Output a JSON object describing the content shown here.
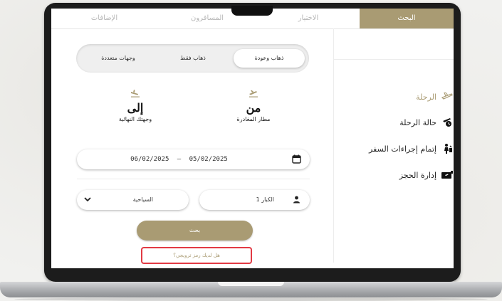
{
  "tabs": [
    {
      "label": "البحث",
      "active": true
    },
    {
      "label": "الاختيار",
      "active": false
    },
    {
      "label": "المسافرون",
      "active": false
    },
    {
      "label": "الإضافات",
      "active": false
    }
  ],
  "sidebar": {
    "items": [
      {
        "label": "الرحلة",
        "icon": "plane-icon"
      },
      {
        "label": "حالة الرحلة",
        "icon": "plane-status-icon"
      },
      {
        "label": "إتمام إجراءات السفر",
        "icon": "traveler-checkin-icon"
      },
      {
        "label": "إدارة الحجز",
        "icon": "ticket-icon"
      }
    ]
  },
  "trip_type": {
    "options": [
      "ذهاب وعودة",
      "ذهاب فقط",
      "وجهات متعددة"
    ],
    "selected": "ذهاب وعودة"
  },
  "origin": {
    "title": "من",
    "subtitle": "مطار المغادرة",
    "icon": "takeoff-icon"
  },
  "destination": {
    "title": "إلى",
    "subtitle": "وجهتك النهائية",
    "icon": "landing-icon"
  },
  "dates": {
    "depart": "05/02/2025",
    "separator": "–",
    "return": "06/02/2025",
    "icon": "calendar-icon"
  },
  "passengers": {
    "label": "1 الكبار",
    "icon": "person-icon"
  },
  "cabin": {
    "label": "السياحية",
    "icon": "chevron-down-icon"
  },
  "search_button": "بحث",
  "promo_link": "هل لديك رمز ترويجي؟",
  "colors": {
    "accent": "#a99b73",
    "highlight": "#e23a44"
  }
}
